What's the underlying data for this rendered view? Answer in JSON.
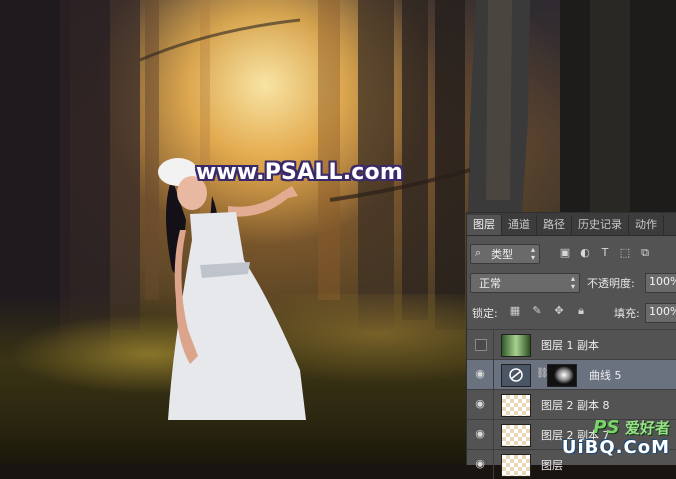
{
  "watermark_text": "www.PSALL.com",
  "layers_panel": {
    "tabs": [
      "图层",
      "通道",
      "路径",
      "历史记录",
      "动作"
    ],
    "filter": {
      "label": "类型"
    },
    "blend_mode": "正常",
    "opacity_label": "不透明度:",
    "opacity_value": "100%",
    "lock_label": "锁定:",
    "fill_label": "填充:",
    "fill_value": "100%",
    "layers": [
      {
        "name": "图层 1 副本",
        "visible": false,
        "thumb": "photo"
      },
      {
        "name": "曲线 5",
        "visible": true,
        "thumb": "adjustment"
      },
      {
        "name": "图层 2 副本 8",
        "visible": true,
        "thumb": "transparent"
      },
      {
        "name": "图层 2 副本 7",
        "visible": true,
        "thumb": "transparent"
      },
      {
        "name": "图层",
        "visible": true,
        "thumb": "transparent"
      }
    ]
  },
  "site_logo": {
    "part1": "PS",
    "part2": "爱好者",
    "part3": "UiBQ.CoM"
  },
  "colors": {
    "panel_bg": "#535353",
    "selected_layer": "#6a7280",
    "watermark_outline": "#3a2a6a"
  }
}
